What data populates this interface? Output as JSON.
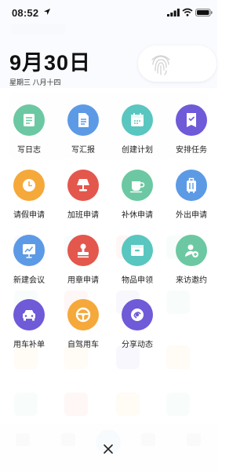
{
  "status_bar": {
    "time": "08:52"
  },
  "date": {
    "big": "9月30日",
    "sub": "星期三  八月十四"
  },
  "colors": {
    "green": "#6cc8a2",
    "blue": "#5d9ae6",
    "teal": "#59c6c0",
    "purple": "#6f5ad8",
    "orange": "#f5a93a",
    "red": "#e3574d"
  },
  "actions": [
    {
      "label": "写日志",
      "icon": "log-icon",
      "color": "green"
    },
    {
      "label": "写汇报",
      "icon": "report-icon",
      "color": "blue"
    },
    {
      "label": "创建计划",
      "icon": "calendar-icon",
      "color": "teal"
    },
    {
      "label": "安排任务",
      "icon": "task-icon",
      "color": "purple"
    },
    {
      "label": "请假申请",
      "icon": "clock-icon",
      "color": "orange"
    },
    {
      "label": "加班申请",
      "icon": "lamp-icon",
      "color": "red"
    },
    {
      "label": "补休申请",
      "icon": "cup-icon",
      "color": "green"
    },
    {
      "label": "外出申请",
      "icon": "luggage-icon",
      "color": "blue"
    },
    {
      "label": "新建会议",
      "icon": "chart-board-icon",
      "color": "blue"
    },
    {
      "label": "用章申请",
      "icon": "stamp-icon",
      "color": "red"
    },
    {
      "label": "物品申领",
      "icon": "box-icon",
      "color": "teal"
    },
    {
      "label": "来访邀约",
      "icon": "visitor-icon",
      "color": "green"
    },
    {
      "label": "用车补单",
      "icon": "car-icon",
      "color": "purple"
    },
    {
      "label": "自驾用车",
      "icon": "steering-wheel-icon",
      "color": "orange"
    },
    {
      "label": "分享动态",
      "icon": "share-icon",
      "color": "purple"
    }
  ]
}
